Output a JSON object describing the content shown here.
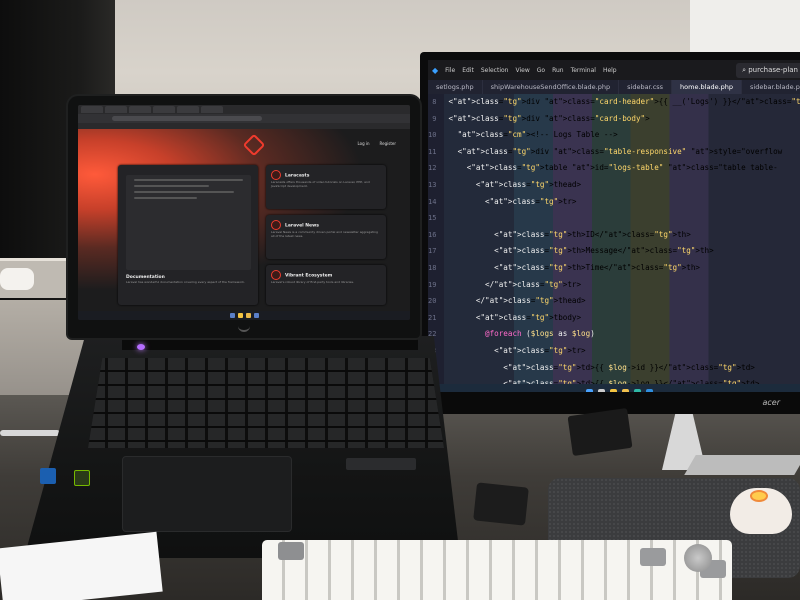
{
  "laptop": {
    "brand_logo": "predator-logo",
    "browser_tabs": [
      "Purchase Plan 2.0",
      "http://localhost",
      "Academic Calendar",
      "FastAPI",
      "Blue Valley",
      "Laravel"
    ],
    "laravel": {
      "nav": [
        "Log in",
        "Register"
      ],
      "cards": [
        {
          "title": "Laracasts",
          "text": "Laracasts offers thousands of video tutorials on Laravel, PHP, and JavaScript development."
        },
        {
          "title": "Laravel News",
          "text": "Laravel News is a community driven portal and newsletter aggregating all of the latest news."
        },
        {
          "title": "Vibrant Ecosystem",
          "text": "Laravel's robust library of first-party tools and libraries."
        }
      ],
      "doc_title": "Documentation",
      "doc_text": "Laravel has wonderful documentation covering every aspect of the framework."
    },
    "keyboard_label": "Enter",
    "accent": "#ef3b2d"
  },
  "monitor": {
    "brand": "acer",
    "menu": [
      "File",
      "Edit",
      "Selection",
      "View",
      "Go",
      "Run",
      "Terminal",
      "Help"
    ],
    "search_text": "purchase-plan",
    "tabs": [
      {
        "label": "setlogs.php",
        "active": false
      },
      {
        "label": "shipWarehouseSendOffice.blade.php",
        "active": false
      },
      {
        "label": "sidebar.css",
        "active": false
      },
      {
        "label": "home.blade.php",
        "active": true
      },
      {
        "label": "sidebar.blade.php",
        "active": false
      }
    ],
    "line_numbers": [
      "8",
      "9",
      "10",
      "11",
      "12",
      "13",
      "14",
      "15",
      "16",
      "17",
      "18",
      "19",
      "20",
      "21",
      "22",
      "23",
      "24"
    ],
    "code_lines": [
      "<div class=\"card-header\">{{ __('Logs') }}</div>",
      "<div class=\"card-body\">",
      "  <!-- Logs Table -->",
      "  <div class=\"table-responsive\" style=\"overflow",
      "    <table id=\"logs-table\" class=\"table table-",
      "      <thead>",
      "        <tr>",
      "",
      "          <th>ID</th>",
      "          <th>Message</th>",
      "          <th>Time</th>",
      "        </tr>",
      "      </thead>",
      "      <tbody>",
      "        @foreach ($logs as $log)",
      "          <tr>",
      "            <td>{{ $log->id }}</td>",
      "            <td>{{ $log->log }}</td>"
    ]
  }
}
